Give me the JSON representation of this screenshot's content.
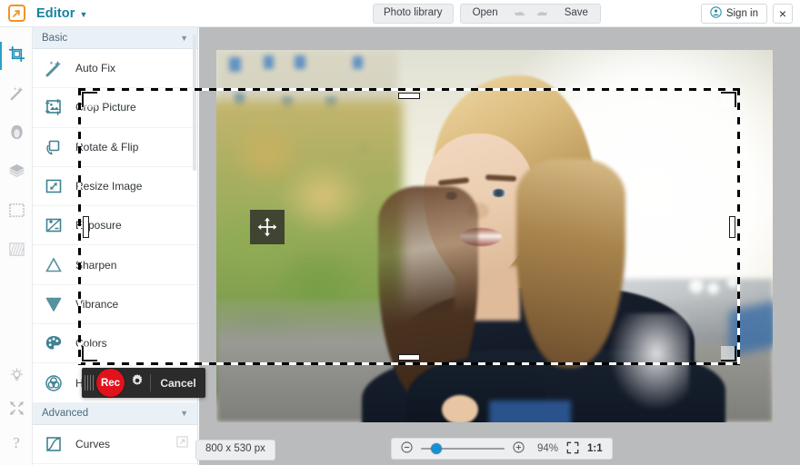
{
  "app": {
    "brand_name": "Editor",
    "logo_icon": "orange-arrow-logo",
    "accent_color": "#17819e",
    "rec_color": "#e1121c"
  },
  "topbar": {
    "photo_library_label": "Photo library",
    "open_label": "Open",
    "save_label": "Save",
    "undo_icon": "undo-arrow-icon",
    "redo_icon": "redo-arrow-icon",
    "sign_in_label": "Sign in",
    "sign_in_icon": "user-circle-icon",
    "close_label": "×"
  },
  "rail": {
    "items": [
      {
        "icon": "crop-icon",
        "name": "crop",
        "active": true
      },
      {
        "icon": "magic-wand-icon",
        "name": "touch-up",
        "active": false
      },
      {
        "icon": "portrait-icon",
        "name": "portrait",
        "active": false
      },
      {
        "icon": "layers-icon",
        "name": "layers",
        "active": false
      },
      {
        "icon": "frame-icon",
        "name": "frames",
        "active": false
      },
      {
        "icon": "texture-icon",
        "name": "textures",
        "active": false
      }
    ],
    "bottom_items": [
      {
        "icon": "lightbulb-icon",
        "name": "ideas"
      },
      {
        "icon": "expand-arrows-icon",
        "name": "fullscreen"
      },
      {
        "icon": "question-mark-icon",
        "name": "help"
      }
    ]
  },
  "sidebar": {
    "sections": [
      {
        "title": "Basic",
        "expanded": true,
        "items": [
          {
            "label": "Auto Fix",
            "icon": "magic-wand-icon"
          },
          {
            "label": "Crop Picture",
            "icon": "crop-picture-icon"
          },
          {
            "label": "Rotate & Flip",
            "icon": "rotate-flip-icon"
          },
          {
            "label": "Resize Image",
            "icon": "resize-icon"
          },
          {
            "label": "Exposure",
            "icon": "exposure-icon"
          },
          {
            "label": "Sharpen",
            "icon": "sharpen-triangle-icon"
          },
          {
            "label": "Vibrance",
            "icon": "vibrance-triangle-icon"
          },
          {
            "label": "Colors",
            "icon": "color-palette-icon"
          },
          {
            "label": "Hue",
            "icon": "hue-venn-icon"
          }
        ]
      },
      {
        "title": "Advanced",
        "expanded": true,
        "items": [
          {
            "label": "Curves",
            "icon": "curves-icon",
            "badge": "expand-badge-icon"
          }
        ]
      }
    ]
  },
  "canvas": {
    "photo_alt": "Smiling young woman with long blonde-brown hair in a navy jacket sitting outdoors on steps, blurred autumn foliage at left and bright sunlit street at right",
    "selection": {
      "move_cursor_icon": "move-arrows-icon",
      "handles": [
        "top-left",
        "top-right",
        "bottom-left",
        "bottom-right",
        "top",
        "bottom",
        "left",
        "right"
      ]
    }
  },
  "rec_toolbar": {
    "grip_icon": "drag-grip-icon",
    "rec_label": "Rec",
    "settings_icon": "gear-icon",
    "cancel_label": "Cancel"
  },
  "bottombar": {
    "dimensions_label": "800 x 530 px",
    "zoom_out_icon": "minus-circle-icon",
    "zoom_in_icon": "plus-circle-icon",
    "zoom_percent": "94%",
    "slider_value": 18,
    "fit_icon": "fit-screen-icon",
    "actual_size_label": "1:1"
  }
}
